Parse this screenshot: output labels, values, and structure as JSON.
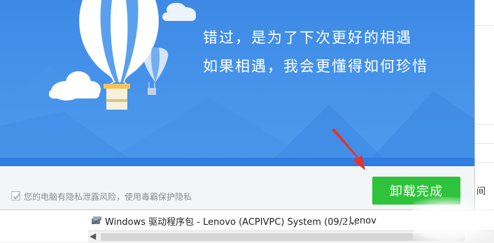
{
  "banner": {
    "line1": "错过，是为了下次更好的相遇",
    "line2": "如果相遇，我会更懂得如何珍惜"
  },
  "footer": {
    "privacy_text": "您的电脑有隐私泄露风险，使用毒霸保护隐私",
    "checkbox_checked": true
  },
  "done_button": {
    "label": "卸载完成"
  },
  "background_list": {
    "row_name": "Windows 驱动程序包 - Lenovo (ACPIVPC) System  (09/2...",
    "row_publisher": "Lenov",
    "right_clip_char": "间"
  },
  "colors": {
    "banner_sky": "#3f8de6",
    "button_green": "#2fc33b",
    "arrow_red": "#e8312a"
  }
}
